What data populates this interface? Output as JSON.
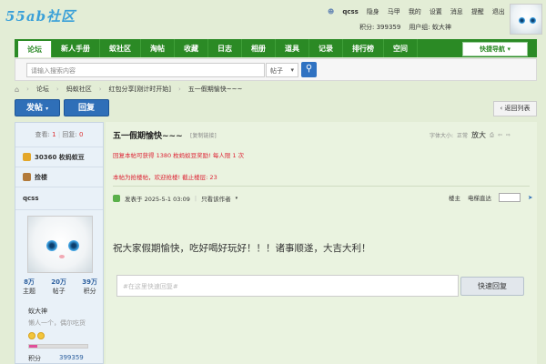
{
  "site": {
    "logo_text": "55ab社区"
  },
  "userbar": {
    "username": "qcss",
    "items": [
      "隐身",
      "马甲",
      "我的",
      "设置",
      "消息",
      "提醒",
      "退出"
    ],
    "points_label": "积分: 399359",
    "group_label": "用户组: 蚁大神"
  },
  "nav": {
    "items": [
      "论坛",
      "新人手册",
      "蚁社区",
      "淘帖",
      "收藏",
      "日志",
      "相册",
      "道具",
      "记录",
      "排行榜",
      "空间"
    ],
    "quick_nav": "快捷导航"
  },
  "search": {
    "placeholder": "请输入搜索内容",
    "type": "帖子"
  },
  "breadcrumb": [
    "论坛",
    "蚂蚁社区",
    "红包分享[刚计时开始]",
    "五一假期愉快~~~"
  ],
  "buttons": {
    "post": "发帖",
    "reply": "回复",
    "return": "返回列表"
  },
  "sidebar": {
    "views_label": "查看:",
    "views": "1",
    "replies_label": "回复:",
    "replies": "0",
    "coins": "30360 枚蚂蚁豆",
    "fish": "捡楼",
    "username": "qcss",
    "stats": [
      {
        "value": "8万",
        "label": "主题"
      },
      {
        "value": "20万",
        "label": "帖子"
      },
      {
        "value": "39万",
        "label": "积分"
      }
    ],
    "rank": "蚁大神",
    "motto": "懒人一个，偶尔吃货",
    "progress": 0.14,
    "points_label": "积分",
    "points_value": "399359"
  },
  "thread": {
    "title": "五一假期愉快~~~",
    "copy_link": "[复制链接]",
    "font_size_label": "字体大小:",
    "font_normal": "正常",
    "font_large": "放大",
    "notice1": "回复本帖可获得 1380 枚蚂蚁豆奖励! 每人限 1 次",
    "notice2": "本帖为抢楼帖，欢迎抢楼!  截止楼层: 23",
    "posted": "发表于 2025-5-1 03:09",
    "author_only": "只看该作者",
    "floor": "楼主",
    "jump_label": "电梯直达",
    "content": "祝大家假期愉快，吃好喝好玩好！！！诸事顺遂，大吉大利！",
    "reply_placeholder": "#在这里快速回复#",
    "quick_reply": "快速回复"
  },
  "colors": {
    "nav_green": "#2b8a25",
    "button_blue": "#2f6fb8",
    "notice_red": "#d23"
  }
}
